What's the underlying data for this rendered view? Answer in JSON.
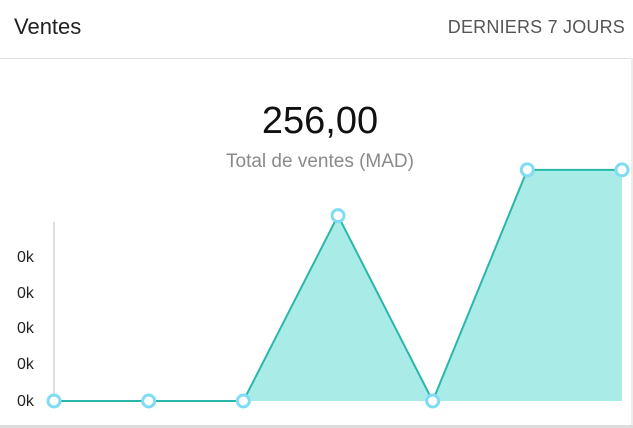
{
  "header": {
    "title": "Ventes",
    "range_label": "DERNIERS 7 JOURS"
  },
  "summary": {
    "total_value": "256,00",
    "total_label": "Total de ventes (MAD)"
  },
  "colors": {
    "area_fill": "#a9ece7",
    "line": "#2ab7a9",
    "point_stroke": "#7fdcf2",
    "point_fill": "#ffffff"
  },
  "chart_data": {
    "type": "area",
    "x": [
      1,
      2,
      3,
      4,
      5,
      6,
      7
    ],
    "values": [
      0,
      0,
      0,
      73,
      0,
      91,
      91
    ],
    "y_tick_labels": [
      "0k",
      "0k",
      "0k",
      "0k",
      "0k"
    ],
    "ylim": [
      0,
      100
    ],
    "grid": false,
    "legend": "none"
  }
}
